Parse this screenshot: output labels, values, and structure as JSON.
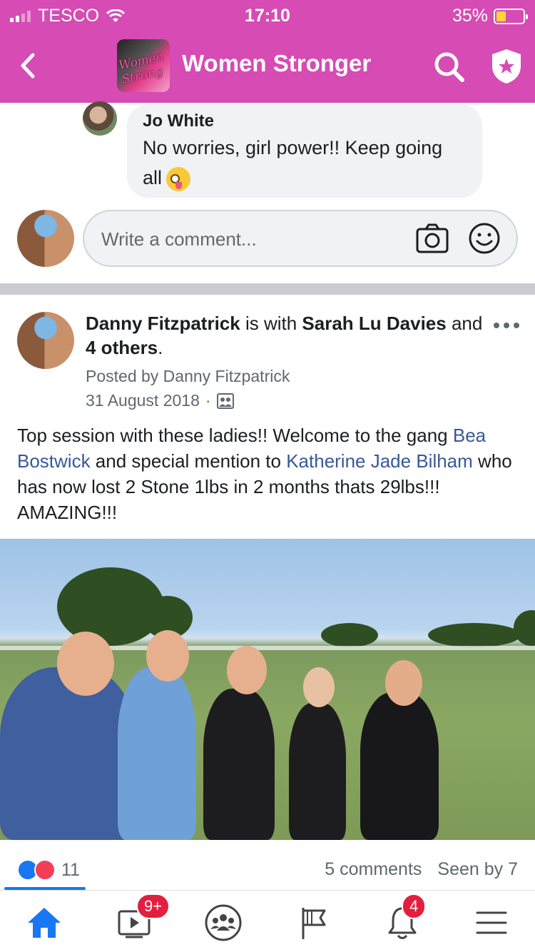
{
  "status_bar": {
    "carrier": "TESCO",
    "time": "17:10",
    "battery": "35%",
    "battery_level": 0.35
  },
  "header": {
    "group_name": "Women Stronger",
    "back_icon": "chevron-left-icon",
    "search_icon": "search-icon",
    "admin_icon": "shield-star-icon"
  },
  "comment": {
    "author": "Jo White",
    "text": "No worries, girl power!! Keep going all",
    "emoji": "zany-face-emoji"
  },
  "comment_input": {
    "placeholder": "Write a comment...",
    "camera_icon": "camera-icon",
    "emoji_icon": "smile-icon"
  },
  "post": {
    "author": "Danny Fitzpatrick",
    "with_text": " is with ",
    "tagged": "Sarah Lu Davies",
    "and_text": " and ",
    "others": "4 others",
    "period": ".",
    "posted_by": "Posted by Danny Fitzpatrick",
    "date": "31 August 2018",
    "separator": "·",
    "body": {
      "part1": "Top session with these ladies!! Welcome to the gang ",
      "mention1": "Bea Bostwick",
      "part2": " and special mention to ",
      "mention2": "Katherine Jade Bilham",
      "part3": " who has now lost 2 Stone 1lbs in 2 months thats 29lbs!!! AMAZING!!!"
    },
    "reaction_count": "11",
    "comments": "5 comments",
    "seen_by": "Seen by 7"
  },
  "tabbar": {
    "items": [
      {
        "icon": "home-icon",
        "active": true
      },
      {
        "icon": "video-icon",
        "badge": "9+"
      },
      {
        "icon": "groups-icon"
      },
      {
        "icon": "pages-flag-icon"
      },
      {
        "icon": "notifications-bell-icon",
        "badge": "4"
      },
      {
        "icon": "menu-icon"
      }
    ]
  },
  "colors": {
    "header_bg": "#d64bb4",
    "link": "#385898",
    "facebook_blue": "#1877f2",
    "badge_red": "#e41e3f"
  }
}
